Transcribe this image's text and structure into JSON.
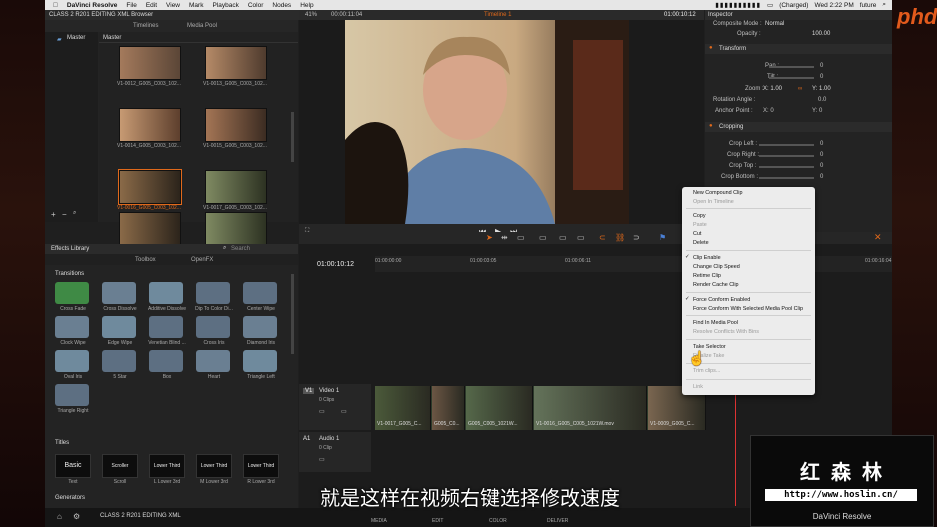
{
  "menubar": {
    "apple": "",
    "app": "DaVinci Resolve",
    "items": [
      "File",
      "Edit",
      "View",
      "Mark",
      "Playback",
      "Color",
      "Nodes",
      "Help"
    ],
    "battery": "(Charged)",
    "time": "Wed 2:22 PM",
    "user": "future"
  },
  "media": {
    "title": "CLASS 2 R201 EDITING XML Browser",
    "tabs": [
      "Timelines",
      "Media Pool"
    ],
    "folder": "Master",
    "bin": "Master",
    "clips": [
      "V1-0012_G005_C003_102...",
      "V1-0013_G005_C003_102...",
      "V1-0014_G005_C003_102...",
      "V1-0015_G005_C003_102...",
      "V1-0016_G005_C003_102...",
      "V1-0017_G005_C003_102...",
      "",
      ""
    ]
  },
  "viewer": {
    "zoom": "41%",
    "src_tc": "00:00:11:04",
    "timeline": "Timeline 1",
    "rec_tc": "01:00:10:12"
  },
  "inspector": {
    "title": "Inspector",
    "composite_label": "Composite Mode :",
    "composite_value": "Normal",
    "opacity_label": "Opacity :",
    "opacity_value": "100.00",
    "transform": "Transform",
    "pan": "Pan :",
    "pan_v": "0",
    "tilt": "Tilt :",
    "tilt_v": "0",
    "zoom": "Zoom :",
    "zoom_x": "X: 1.00",
    "zoom_y": "Y: 1.00",
    "rot": "Rotation Angle :",
    "rot_v": "0.0",
    "anchor": "Anchor Point :",
    "anchor_x": "X: 0",
    "anchor_y": "Y: 0",
    "cropping": "Cropping",
    "crop_left": "Crop Left :",
    "crop_right": "Crop Right :",
    "crop_top": "Crop Top :",
    "crop_bottom": "Crop Bottom :",
    "crop_v": "0"
  },
  "effects": {
    "title": "Effects Library",
    "search": "Search",
    "tabs": [
      "Toolbox",
      "OpenFX"
    ],
    "section_transitions": "Transitions",
    "transitions": [
      "Cross Fade",
      "Cross Dissolve",
      "Additive Dissolve",
      "Dip To Color Di...",
      "Center Wipe",
      "Clock Wipe",
      "Edge Wipe",
      "Venetian Blind ...",
      "Cross Iris",
      "Diamond Iris",
      "Oval Iris",
      "5 Star",
      "Box",
      "Heart",
      "Triangle Left",
      "Triangle Right"
    ],
    "section_titles": "Titles",
    "titles": [
      {
        "label": "Basic",
        "cap": "Text"
      },
      {
        "label": "Scroller",
        "cap": "Scroll"
      },
      {
        "label": "Lower Third",
        "cap": "L Lower 3rd"
      },
      {
        "label": "Lower Third",
        "cap": "M Lower 3rd"
      },
      {
        "label": "Lower Third",
        "cap": "R Lower 3rd"
      }
    ],
    "section_generators": "Generators"
  },
  "timeline": {
    "tc": "01:00:10:12",
    "ruler": [
      "01:00:00:00",
      "01:00:03:05",
      "01:00:06:11",
      "01:00:16:04"
    ],
    "v1": {
      "id": "V1",
      "name": "Video 1",
      "clips": "0 Clips"
    },
    "a1": {
      "id": "A1",
      "name": "Audio 1",
      "clips": "0 Clip"
    },
    "clip_names": [
      "V1-0017_G005_C...",
      "G005_C0...",
      "G005_C005_1021W...",
      "V1-0016_G005_C005_1021W.mov",
      "V1-0009_G005_C..."
    ]
  },
  "context_menu": [
    "New Compound Clip",
    "Open In Timeline",
    "Copy",
    "Paste",
    "Cut",
    "Delete",
    "Clip Enable",
    "Change Clip Speed",
    "Retime Clip",
    "Render Cache Clip",
    "Force Conform Enabled",
    "Force Conform With Selected Media Pool Clip",
    "Find In Media Pool",
    "Resolve Conflicts With Bins",
    "Take Selector",
    "Finalize Take",
    "Trim clips...",
    "Link"
  ],
  "pages": [
    "MEDIA",
    "EDIT",
    "COLOR",
    "DELIVER"
  ],
  "project": "CLASS 2 R201 EDITING XML",
  "subtitle": "就是这样在视频右键选择修改速度",
  "watermark": {
    "brand": "红 森 林",
    "url": "http://www.hoslin.cn/",
    "caption": "DaVinci Resolve",
    "logo": "phd"
  }
}
